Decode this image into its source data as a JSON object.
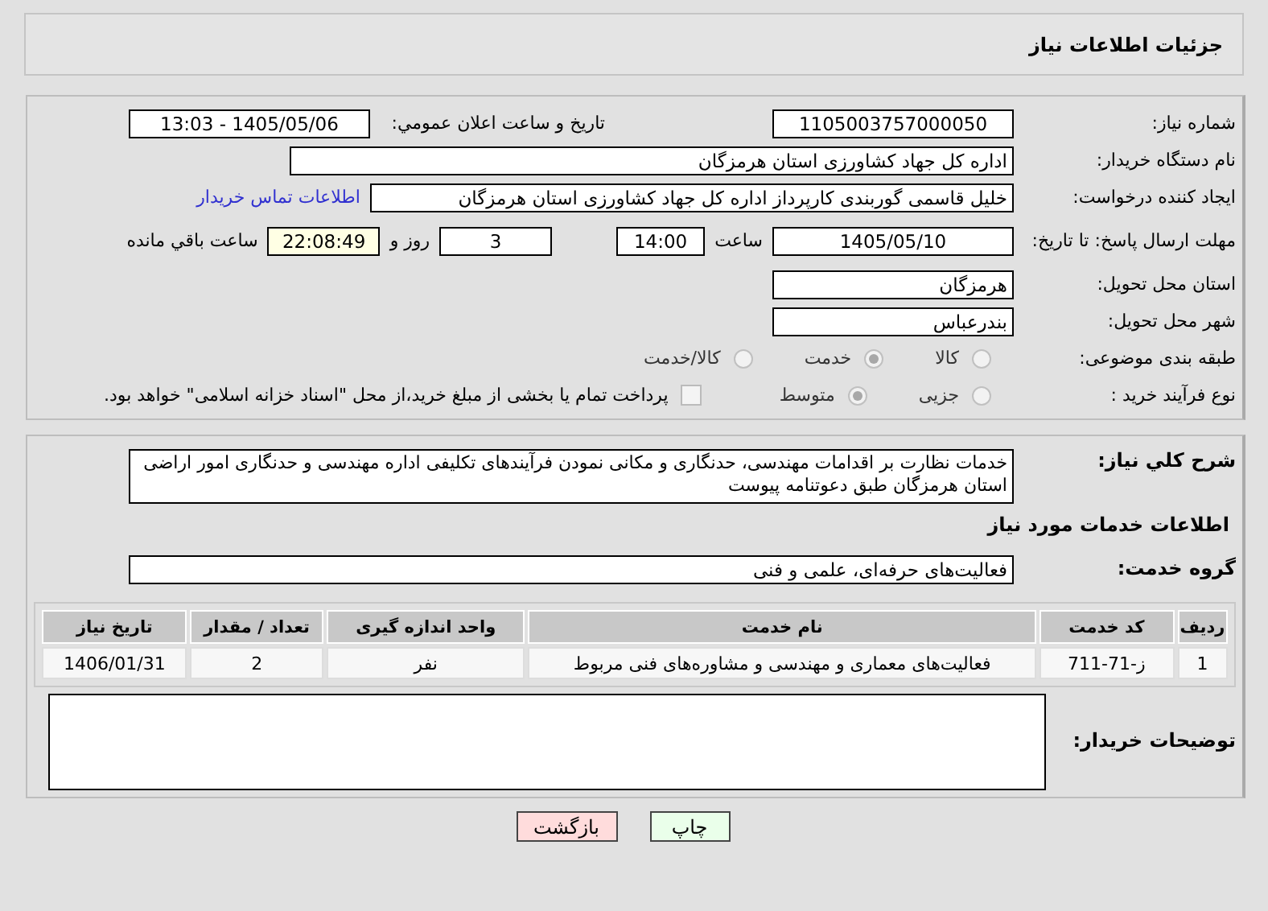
{
  "header": {
    "title": "جزئیات اطلاعات نیاز"
  },
  "need_number": {
    "label": "شماره نیاز:",
    "value": "1105003757000050"
  },
  "announce": {
    "label": "تاریخ و ساعت اعلان عمومي:",
    "value": "1405/05/06 - 13:03"
  },
  "buyer_org": {
    "label": "نام دستگاه خریدار:",
    "value": "اداره کل جهاد کشاورزی استان هرمزگان"
  },
  "requester": {
    "label": "ایجاد کننده درخواست:",
    "value": "خلیل قاسمی گوربندی کارپرداز اداره کل جهاد کشاورزی استان هرمزگان",
    "link": "اطلاعات تماس خریدار"
  },
  "deadline": {
    "label": "مهلت ارسال پاسخ: تا تاریخ:",
    "date": "1405/05/10",
    "time_label": "ساعت",
    "time": "14:00",
    "days": "3",
    "days_label": "روز و",
    "remaining": "22:08:49",
    "remaining_label": "ساعت باقي مانده"
  },
  "province": {
    "label": "استان محل تحویل:",
    "value": "هرمزگان"
  },
  "city": {
    "label": "شهر محل تحویل:",
    "value": "بندرعباس"
  },
  "category": {
    "label": "طبقه بندی موضوعی:",
    "options": [
      {
        "label": "کالا",
        "selected": false
      },
      {
        "label": "خدمت",
        "selected": true
      },
      {
        "label": "کالا/خدمت",
        "selected": false
      }
    ]
  },
  "process": {
    "label": "نوع فرآیند خرید :",
    "options": [
      {
        "label": "جزیی",
        "selected": false
      },
      {
        "label": "متوسط",
        "selected": true
      }
    ],
    "treasury": {
      "checked": false,
      "text": "پرداخت تمام یا بخشی از مبلغ خرید،از محل \"اسناد خزانه اسلامی\" خواهد بود."
    }
  },
  "description": {
    "label": "شرح کلي نیاز:",
    "value": "خدمات نظارت بر اقدامات مهندسی، حدنگاری و مکانی نمودن فرآیندهای تکلیفی اداره مهندسی و حدنگاری امور اراضی استان هرمزگان طبق دعوتنامه پیوست"
  },
  "services_heading": "اطلاعات خدمات مورد نیاز",
  "service_group": {
    "label": "گروه خدمت:",
    "value": "فعالیت‌های حرفه‌ای، علمی و فنی"
  },
  "table": {
    "columns": [
      "ردیف",
      "کد خدمت",
      "نام خدمت",
      "واحد اندازه گیری",
      "تعداد / مقدار",
      "تاریخ نیاز"
    ],
    "rows": [
      [
        "1",
        "ز-71-711",
        "فعالیت‌های معماری و مهندسی و مشاوره‌های فنی مربوط",
        "نفر",
        "2",
        "1406/01/31"
      ]
    ]
  },
  "buyer_notes": {
    "label": "توضیحات خریدار:"
  },
  "buttons": [
    {
      "label": "چاپ",
      "kind": "print"
    },
    {
      "label": "بازگشت",
      "kind": "back"
    }
  ]
}
